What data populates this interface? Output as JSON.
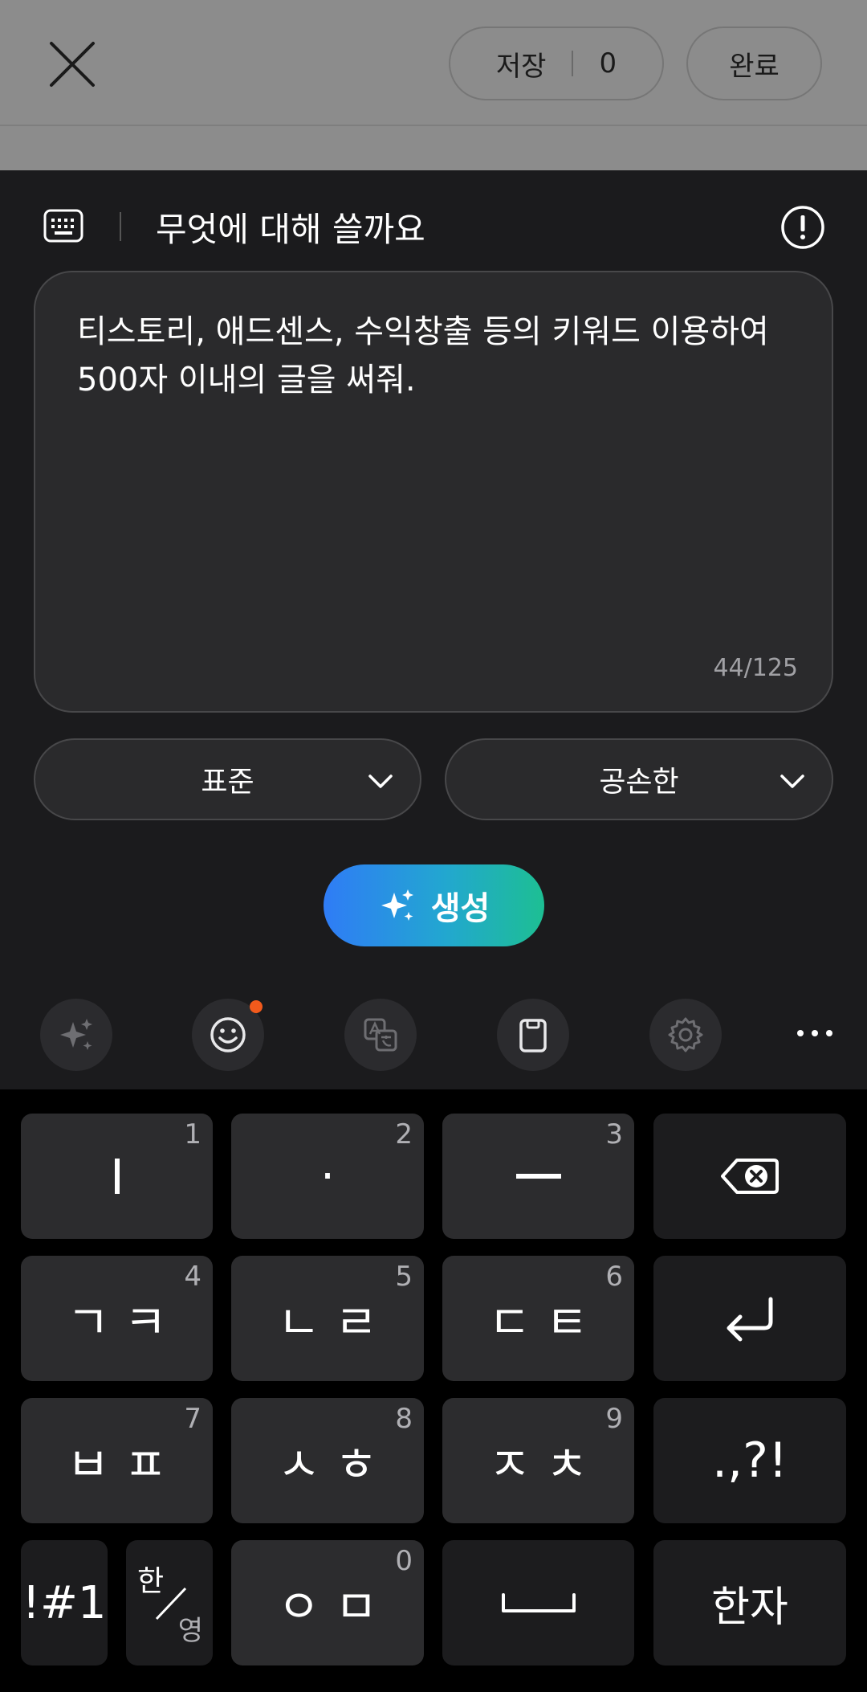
{
  "top_bar": {
    "close_icon": "close-icon",
    "save_label": "저장",
    "save_count": "0",
    "done_label": "완료"
  },
  "panel": {
    "keyboard_icon": "keyboard-icon",
    "title": "무엇에 대해 쓸까요",
    "info_icon": "info-icon",
    "prompt_text": "티스토리, 애드센스, 수익창출 등의 키워드 이용하여 500자 이내의 글을 써줘.",
    "char_counter": "44/125",
    "length_select": "표준",
    "tone_select": "공손한",
    "generate_label": "생성",
    "colors": {
      "accent_start": "#2f7cf6",
      "accent_end": "#1dbf93",
      "badge": "#f25a1c"
    }
  },
  "toolbar": {
    "items": [
      "ai-sparkle-icon",
      "emoji-icon",
      "translate-icon",
      "clipboard-icon",
      "settings-icon",
      "more-icon"
    ]
  },
  "keyboard": {
    "row1": [
      {
        "label": "ㅣ",
        "num": "1"
      },
      {
        "label": "·",
        "num": "2"
      },
      {
        "label": "ㅡ",
        "num": "3"
      },
      {
        "label": "backspace-icon"
      }
    ],
    "row2": [
      {
        "label": "ㄱㅋ",
        "num": "4"
      },
      {
        "label": "ㄴㄹ",
        "num": "5"
      },
      {
        "label": "ㄷㅌ",
        "num": "6"
      },
      {
        "label": "enter-icon"
      }
    ],
    "row3": [
      {
        "label": "ㅂㅍ",
        "num": "7"
      },
      {
        "label": "ㅅㅎ",
        "num": "8"
      },
      {
        "label": "ㅈㅊ",
        "num": "9"
      },
      {
        "label": ".,?!"
      }
    ],
    "row4": [
      {
        "label": "!#1"
      },
      {
        "label_top": "한",
        "label_bottom": "영"
      },
      {
        "label": "ㅇㅁ",
        "num": "0"
      },
      {
        "label": "space-icon"
      },
      {
        "label": "한자"
      }
    ]
  }
}
